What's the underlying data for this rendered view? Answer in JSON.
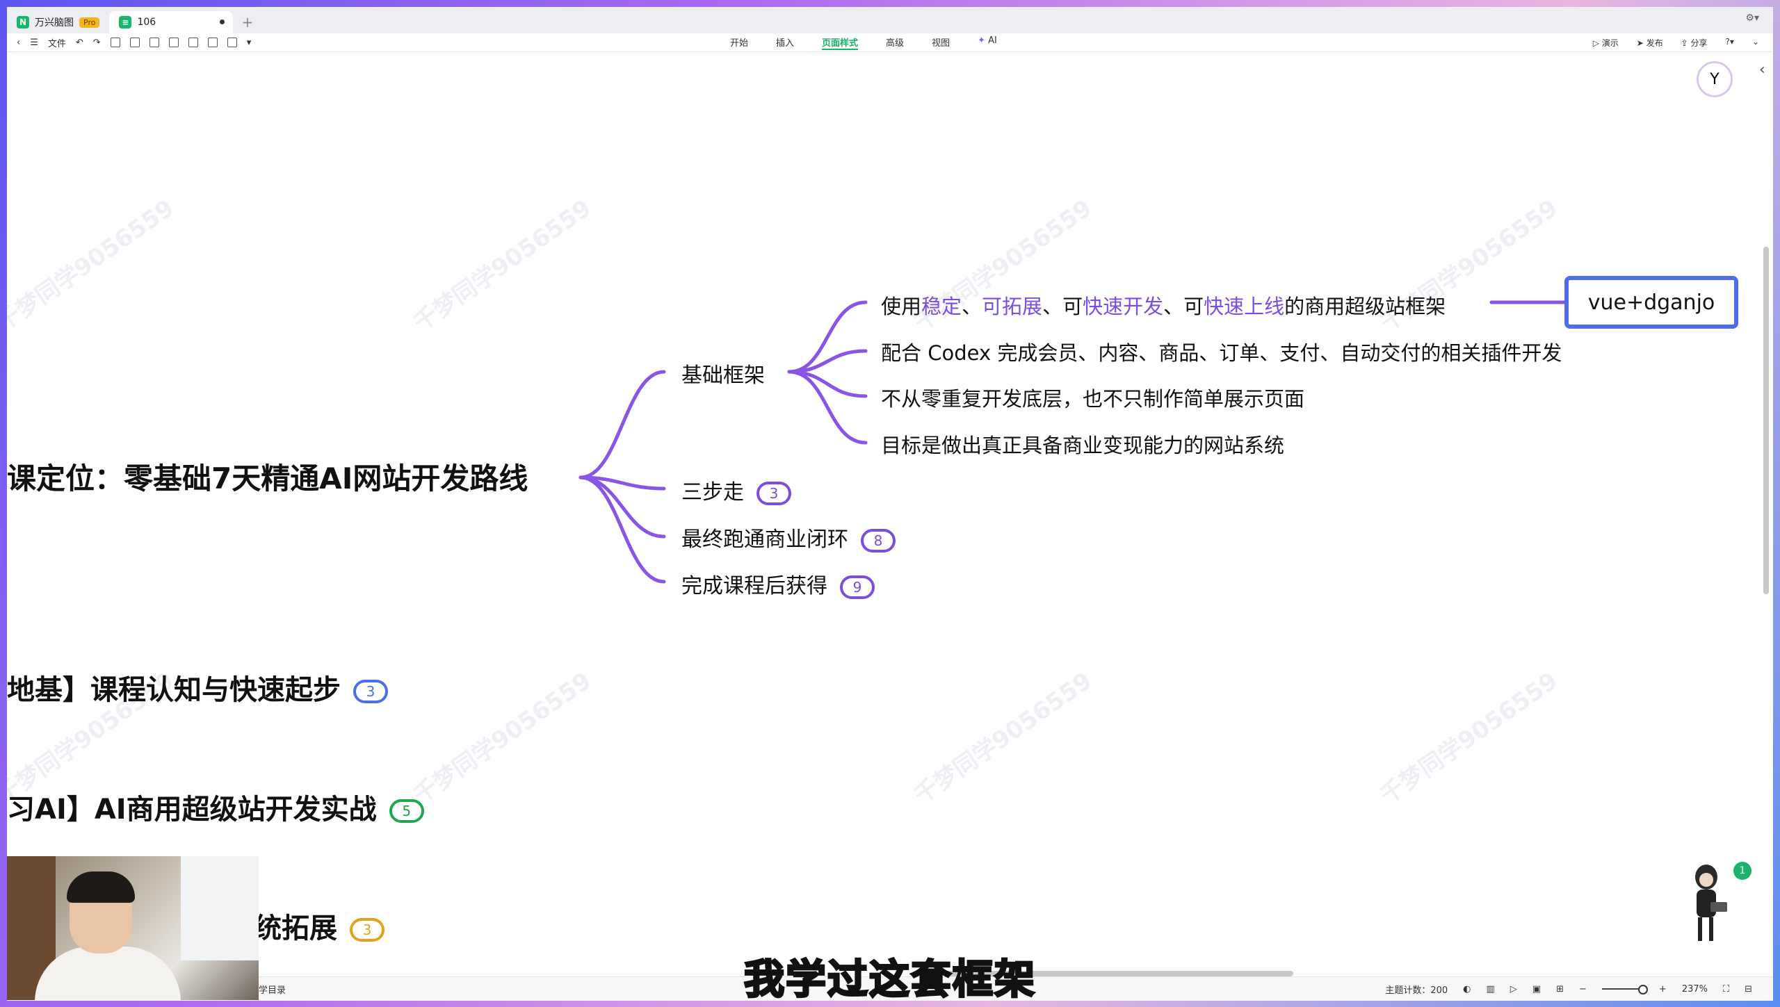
{
  "tabs": {
    "app_name": "万兴脑图",
    "app_badge": "Pro",
    "doc_name": "106",
    "new_tab": "+"
  },
  "toolbar": {
    "file_label": "文件",
    "menus": [
      "开始",
      "插入",
      "页面样式",
      "高级",
      "视图",
      "AI"
    ],
    "active_menu": "页面样式",
    "present_label": "演示",
    "publish_label": "发布",
    "share_label": "分享"
  },
  "mindmap": {
    "root": "课定位：零基础7天精通AI网站开发路线",
    "branches": [
      {
        "label": "基础框架",
        "children": [
          {
            "parts": [
              "使用",
              "稳定",
              "、",
              "可拓展",
              "、可",
              "快速开发",
              "、可",
              "快速上线",
              "的商用超级站框架"
            ]
          },
          {
            "text": "配合 Codex 完成会员、内容、商品、订单、支付、自动交付的相关插件开发"
          },
          {
            "text": "不从零重复开发底层，也不只制作简单展示页面"
          },
          {
            "text": "目标是做出真正具备商业变现能力的网站系统"
          }
        ]
      },
      {
        "label": "三步走",
        "count": "3"
      },
      {
        "label": "最终跑通商业闭环",
        "count": "8"
      },
      {
        "label": "完成课程后获得",
        "count": "9"
      }
    ],
    "detail_box": "vue+dganjo",
    "sections": [
      {
        "label": "地基】课程认知与快速起步",
        "count": "3"
      },
      {
        "label": "习AI】AI商用超级站开发实战",
        "count": "5"
      },
      {
        "label": "统拓展",
        "count": "3"
      }
    ],
    "watermark": "千梦同学9056559"
  },
  "statusbar": {
    "left_label": "学目录",
    "topic_count_label": "主题计数：",
    "topic_count": "200",
    "zoom": "237%"
  },
  "subtitle": "我学过这套框架",
  "notification_count": "1"
}
